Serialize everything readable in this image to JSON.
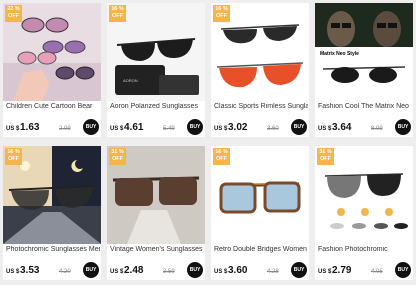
{
  "products": [
    {
      "title": "Children Cute Cartoon Bear",
      "currency": "US $",
      "price": "1.63",
      "original": "2.09",
      "badge_pct": "22 %",
      "badge_off": "OFF",
      "buy": "BUY"
    },
    {
      "title": "Aoron Polarized Sunglasses",
      "currency": "US $",
      "price": "4.61",
      "original": "5.49",
      "badge_pct": "16 %",
      "badge_off": "OFF",
      "buy": "BUY"
    },
    {
      "title": "Classic Sports Rimless Sunglasses",
      "currency": "US $",
      "price": "3.02",
      "original": "3.60",
      "badge_pct": "16 %",
      "badge_off": "OFF",
      "buy": "BUY"
    },
    {
      "title": "Fashion Cool The Matrix Neo",
      "currency": "US $",
      "price": "3.64",
      "original": "8.09",
      "badge_pct": "",
      "badge_off": "",
      "buy": "BUY",
      "image_caption": "Matrix Neo Style"
    },
    {
      "title": "Photochromic Sunglasses Men",
      "currency": "US $",
      "price": "3.53",
      "original": "4.20",
      "badge_pct": "16 %",
      "badge_off": "OFF",
      "buy": "BUY"
    },
    {
      "title": "Vintage Women's Sunglasses",
      "currency": "US $",
      "price": "2.48",
      "original": "3.59",
      "badge_pct": "31 %",
      "badge_off": "OFF",
      "buy": "BUY"
    },
    {
      "title": "Retro Double Bridges Women",
      "currency": "US $",
      "price": "3.60",
      "original": "4.28",
      "badge_pct": "16 %",
      "badge_off": "OFF",
      "buy": "BUY"
    },
    {
      "title": "Fashion Photochromic",
      "currency": "US $",
      "price": "2.79",
      "original": "4.05",
      "badge_pct": "31 %",
      "badge_off": "OFF",
      "buy": "BUY"
    }
  ],
  "colors": {
    "badge": "#f7b44a",
    "buy": "#111111",
    "background": "#eeeeee"
  }
}
